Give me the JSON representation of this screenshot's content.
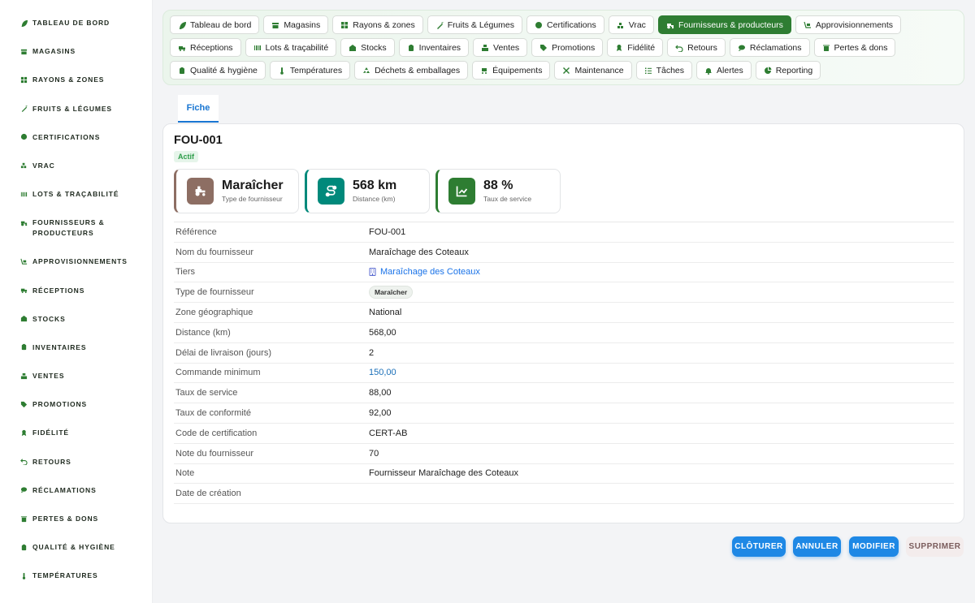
{
  "sidebar": {
    "items": [
      {
        "label": "TABLEAU DE BORD",
        "icon": "leaf-icon"
      },
      {
        "label": "MAGASINS",
        "icon": "store-icon"
      },
      {
        "label": "RAYONS & ZONES",
        "icon": "grid-icon"
      },
      {
        "label": "FRUITS & LÉGUMES",
        "icon": "carrot-icon"
      },
      {
        "label": "CERTIFICATIONS",
        "icon": "badge-icon"
      },
      {
        "label": "VRAC",
        "icon": "bulk-icon"
      },
      {
        "label": "LOTS & TRAÇABILITÉ",
        "icon": "barcode-icon"
      },
      {
        "label": "FOURNISSEURS & PRODUCTEURS",
        "icon": "tractor-icon"
      },
      {
        "label": "APPROVISIONNEMENTS",
        "icon": "dolly-icon"
      },
      {
        "label": "RÉCEPTIONS",
        "icon": "truck-icon"
      },
      {
        "label": "STOCKS",
        "icon": "warehouse-icon"
      },
      {
        "label": "INVENTAIRES",
        "icon": "clipboard-icon"
      },
      {
        "label": "VENTES",
        "icon": "cash-register-icon"
      },
      {
        "label": "PROMOTIONS",
        "icon": "tag-icon"
      },
      {
        "label": "FIDÉLITÉ",
        "icon": "award-icon"
      },
      {
        "label": "RETOURS",
        "icon": "undo-icon"
      },
      {
        "label": "RÉCLAMATIONS",
        "icon": "comment-icon"
      },
      {
        "label": "PERTES & DONS",
        "icon": "trash-icon"
      },
      {
        "label": "QUALITÉ & HYGIÈNE",
        "icon": "clipboard-check-icon"
      },
      {
        "label": "TEMPÉRATURES",
        "icon": "thermometer-icon"
      }
    ]
  },
  "modules": [
    {
      "label": "Tableau de bord",
      "icon": "leaf-icon",
      "active": false
    },
    {
      "label": "Magasins",
      "icon": "store-icon",
      "active": false
    },
    {
      "label": "Rayons & zones",
      "icon": "grid-icon",
      "active": false
    },
    {
      "label": "Fruits & Légumes",
      "icon": "carrot-icon",
      "active": false
    },
    {
      "label": "Certifications",
      "icon": "badge-icon",
      "active": false
    },
    {
      "label": "Vrac",
      "icon": "bulk-icon",
      "active": false
    },
    {
      "label": "Fournisseurs & producteurs",
      "icon": "tractor-icon",
      "active": true
    },
    {
      "label": "Approvisionnements",
      "icon": "dolly-icon",
      "active": false
    },
    {
      "label": "Réceptions",
      "icon": "truck-icon",
      "active": false
    },
    {
      "label": "Lots & traçabilité",
      "icon": "barcode-icon",
      "active": false
    },
    {
      "label": "Stocks",
      "icon": "warehouse-icon",
      "active": false
    },
    {
      "label": "Inventaires",
      "icon": "clipboard-icon",
      "active": false
    },
    {
      "label": "Ventes",
      "icon": "cash-register-icon",
      "active": false
    },
    {
      "label": "Promotions",
      "icon": "tag-icon",
      "active": false
    },
    {
      "label": "Fidélité",
      "icon": "award-icon",
      "active": false
    },
    {
      "label": "Retours",
      "icon": "undo-icon",
      "active": false
    },
    {
      "label": "Réclamations",
      "icon": "comment-icon",
      "active": false
    },
    {
      "label": "Pertes & dons",
      "icon": "trash-icon",
      "active": false
    },
    {
      "label": "Qualité & hygiène",
      "icon": "clipboard-check-icon",
      "active": false
    },
    {
      "label": "Températures",
      "icon": "thermometer-icon",
      "active": false
    },
    {
      "label": "Déchets & emballages",
      "icon": "recycle-icon",
      "active": false
    },
    {
      "label": "Équipements",
      "icon": "cart-icon",
      "active": false
    },
    {
      "label": "Maintenance",
      "icon": "tools-icon",
      "active": false
    },
    {
      "label": "Tâches",
      "icon": "list-check-icon",
      "active": false
    },
    {
      "label": "Alertes",
      "icon": "bell-icon",
      "active": false
    },
    {
      "label": "Reporting",
      "icon": "pie-chart-icon",
      "active": false
    }
  ],
  "tabs": {
    "fiche": "Fiche"
  },
  "record": {
    "title": "FOU-001",
    "status": "Actif"
  },
  "kpis": [
    {
      "value": "Maraîcher",
      "label": "Type de fournisseur",
      "icon": "tractor-icon",
      "color": "#8d6e63"
    },
    {
      "value": "568 km",
      "label": "Distance (km)",
      "icon": "route-icon",
      "color": "#00897b"
    },
    {
      "value": "88 %",
      "label": "Taux de service",
      "icon": "chart-line-icon",
      "color": "#2e7d32"
    }
  ],
  "fields": [
    {
      "label": "Référence",
      "value": "FOU-001"
    },
    {
      "label": "Nom du fournisseur",
      "value": "Maraîchage des Coteaux"
    },
    {
      "label": "Tiers",
      "value": "Maraîchage des Coteaux"
    },
    {
      "label": "Type de fournisseur",
      "value": "Maraîcher"
    },
    {
      "label": "Zone géographique",
      "value": "National"
    },
    {
      "label": "Distance (km)",
      "value": "568,00"
    },
    {
      "label": "Délai de livraison (jours)",
      "value": "2"
    },
    {
      "label": "Commande minimum",
      "value": "150,00"
    },
    {
      "label": "Taux de service",
      "value": "88,00"
    },
    {
      "label": "Taux de conformité",
      "value": "92,00"
    },
    {
      "label": "Code de certification",
      "value": "CERT-AB"
    },
    {
      "label": "Note du fournisseur",
      "value": "70"
    },
    {
      "label": "Note",
      "value": "Fournisseur Maraîchage des Coteaux"
    },
    {
      "label": "Date de création",
      "value": ""
    }
  ],
  "actions": {
    "cloturer": "CLÔTURER",
    "annuler": "ANNULER",
    "modifier": "MODIFIER",
    "supprimer": "SUPPRIMER"
  },
  "colors": {
    "brand_green": "#2e7d32",
    "primary_blue": "#1e88e5",
    "link_blue": "#1a73e8"
  }
}
